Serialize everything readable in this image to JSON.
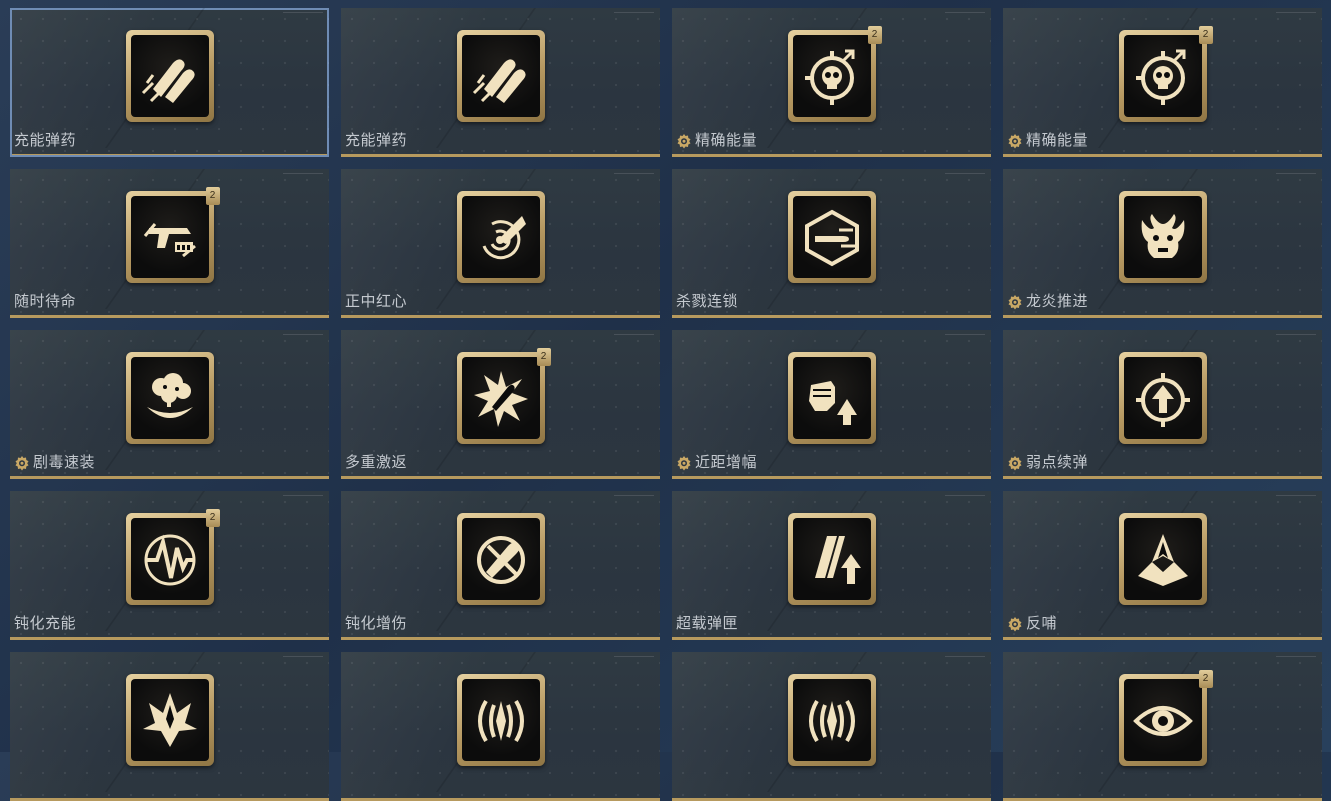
{
  "colors": {
    "accent_gold": "#b79a5e",
    "label": "#c4c9cf",
    "selection": "#6f8cb4"
  },
  "cards": [
    {
      "label": "充能弹药",
      "icon": "twin-bullets-icon",
      "badge": false,
      "tier": "",
      "selected": true
    },
    {
      "label": "充能弹药",
      "icon": "twin-bullets-icon",
      "badge": false,
      "tier": ""
    },
    {
      "label": "精确能量",
      "icon": "skull-target-icon",
      "badge": true,
      "tier": "2"
    },
    {
      "label": "精确能量",
      "icon": "skull-target-icon",
      "badge": true,
      "tier": "2"
    },
    {
      "label": "随时待命",
      "icon": "pistol-reload-icon",
      "badge": false,
      "tier": "2"
    },
    {
      "label": "正中红心",
      "icon": "bullseye-impact-icon",
      "badge": false,
      "tier": ""
    },
    {
      "label": "杀戮连锁",
      "icon": "bullet-chain-icon",
      "badge": false,
      "tier": ""
    },
    {
      "label": "龙炎推进",
      "icon": "dragon-head-icon",
      "badge": true,
      "tier": ""
    },
    {
      "label": "剧毒速装",
      "icon": "toxic-cloud-icon",
      "badge": true,
      "tier": ""
    },
    {
      "label": "多重激返",
      "icon": "bullet-burst-icon",
      "badge": false,
      "tier": "2"
    },
    {
      "label": "近距增幅",
      "icon": "fist-arrow-icon",
      "badge": true,
      "tier": ""
    },
    {
      "label": "弱点续弹",
      "icon": "target-arrow-icon",
      "badge": true,
      "tier": ""
    },
    {
      "label": "钝化充能",
      "icon": "pulse-wave-icon",
      "badge": false,
      "tier": "2"
    },
    {
      "label": "钝化增伤",
      "icon": "crossed-bullet-icon",
      "badge": false,
      "tier": ""
    },
    {
      "label": "超载弹匣",
      "icon": "magazine-up-icon",
      "badge": false,
      "tier": ""
    },
    {
      "label": "反哺",
      "icon": "crystal-spikes-icon",
      "badge": true,
      "tier": ""
    },
    {
      "label": "",
      "icon": "spiked-crown-icon",
      "badge": false,
      "tier": ""
    },
    {
      "label": "",
      "icon": "claw-orb-icon",
      "badge": false,
      "tier": ""
    },
    {
      "label": "",
      "icon": "claw-orb-icon",
      "badge": false,
      "tier": ""
    },
    {
      "label": "",
      "icon": "eye-icon",
      "badge": false,
      "tier": "2"
    }
  ]
}
